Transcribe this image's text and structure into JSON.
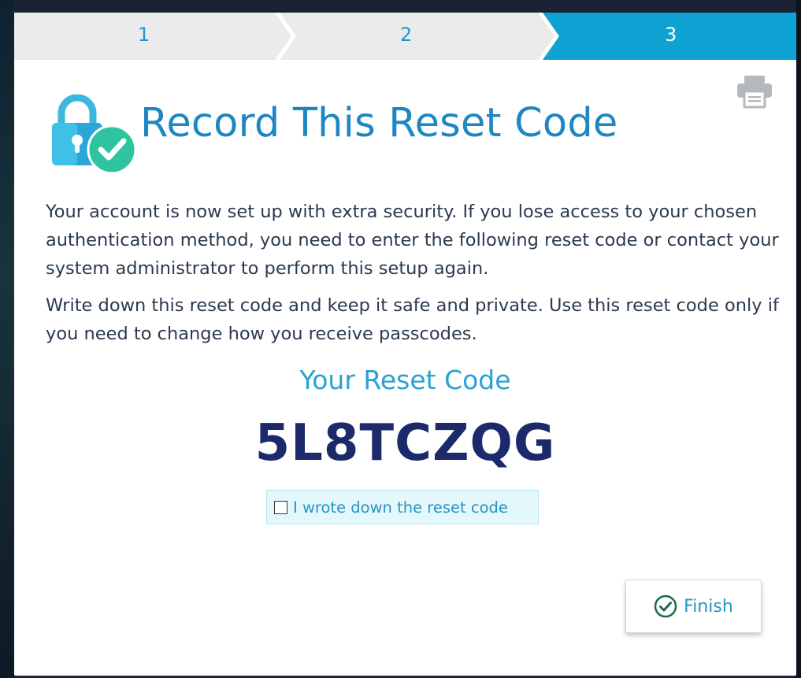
{
  "wizard": {
    "steps": [
      {
        "label": "1",
        "state": "completed"
      },
      {
        "label": "2",
        "state": "completed"
      },
      {
        "label": "3",
        "state": "active"
      }
    ],
    "colors": {
      "inactive_step_bg": "#ebebeb",
      "active_step_bg": "#0ea3d3",
      "step_text": "#2196c9",
      "title": "#1f86c4",
      "code": "#1c2a6b",
      "accent_green": "#2ec4a0"
    }
  },
  "dialog": {
    "title": "Record This Reset Code",
    "header_icon": "lock-check-icon",
    "print_icon": "printer-icon",
    "paragraph1": "Your account is now set up with extra security. If you lose access to your chosen authentication method, you need to enter the following reset code or contact your system administrator to perform this setup again.",
    "paragraph2": "Write down this reset code and keep it safe and private. Use this reset code only if you need to change how you receive passcodes.",
    "code_heading": "Your Reset Code",
    "reset_code": "5L8TCZQG",
    "confirm_label": "I wrote down the reset code",
    "confirm_checked": false,
    "finish_label": "Finish",
    "finish_icon": "check-circle-icon"
  }
}
